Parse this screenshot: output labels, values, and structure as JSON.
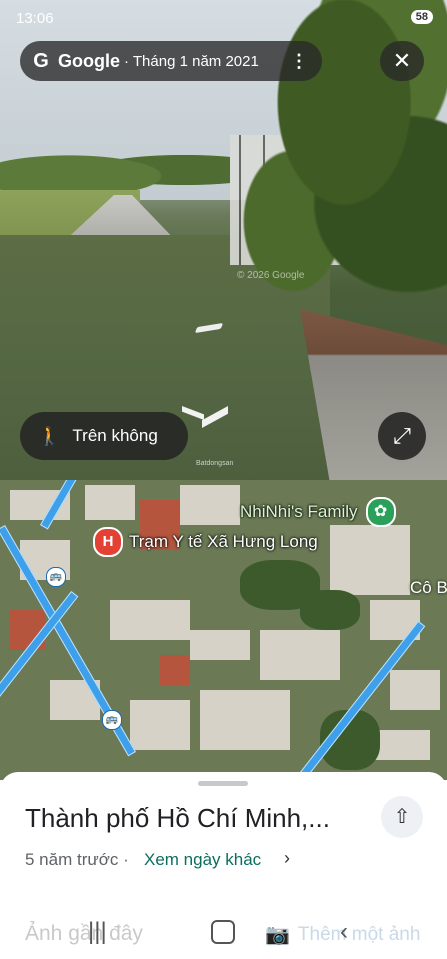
{
  "status_bar": {
    "time": "13:06",
    "battery": "58"
  },
  "street_view": {
    "top_bar": {
      "logo_letter": "G",
      "brand": "Google",
      "date": "· Tháng 1 năm 2021",
      "more_label": "⋮"
    },
    "close_label": "✕",
    "watermark": "© 2026 Google",
    "source_badge": "Batdongsan",
    "aerial_button_label": "Trên không",
    "expand_label": "⤢"
  },
  "map": {
    "poi_clinic": {
      "icon_letter": "H",
      "label": "Trạm Y tế Xã Hưng Long"
    },
    "poi_family": {
      "label": "NhiNhi's Family"
    },
    "poi_partial": {
      "label": "Cô B"
    }
  },
  "sheet": {
    "title": "Thành phố Hồ Chí Minh,...",
    "share_label": "⇧",
    "time_ago": "5 năm trước ·",
    "other_day_link": "Xem ngày khác",
    "chevron": "›",
    "recent_label": "Ảnh gần đây",
    "add_photo_label": "Thêm một ảnh"
  }
}
